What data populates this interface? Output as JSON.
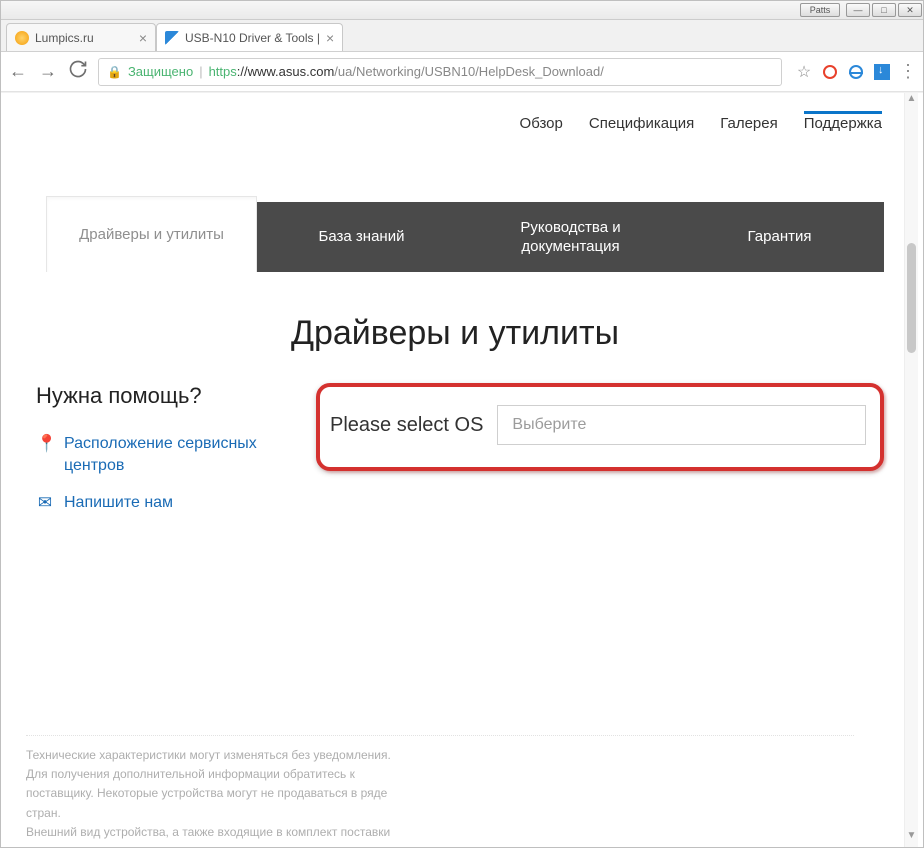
{
  "window": {
    "buttons_label": "Patts"
  },
  "tabs": [
    {
      "title": "Lumpics.ru",
      "favicon": "orange"
    },
    {
      "title": "USB-N10 Driver & Tools |",
      "favicon": "blue",
      "active": true
    }
  ],
  "addressbar": {
    "secure_label": "Защищено",
    "protocol": "https",
    "host": "://www.asus.com",
    "path": "/ua/Networking/USBN10/HelpDesk_Download/"
  },
  "top_nav": {
    "items": [
      "Обзор",
      "Спецификация",
      "Галерея",
      "Поддержка"
    ],
    "active_index": 3
  },
  "support_tabs": {
    "items": [
      "Драйверы и утилиты",
      "База знаний",
      "Руководства и документация",
      "Гарантия"
    ],
    "active_index": 0
  },
  "headline": "Драйверы и утилиты",
  "help": {
    "title": "Нужна помощь?",
    "links": [
      {
        "icon": "pin",
        "text": "Расположение сервисных центров"
      },
      {
        "icon": "mail",
        "text": "Напишите нам"
      }
    ]
  },
  "os_selector": {
    "label": "Please select OS",
    "placeholder": "Выберите"
  },
  "disclaimer": {
    "line1": "Технические характеристики могут изменяться без уведомления.",
    "line2": "Для получения дополнительной информации обратитесь к",
    "line3": "поставщику. Некоторые устройства могут не продаваться в ряде",
    "line4": "стран.",
    "line5": "Внешний вид устройства, а также входящие в комплект поставки"
  }
}
